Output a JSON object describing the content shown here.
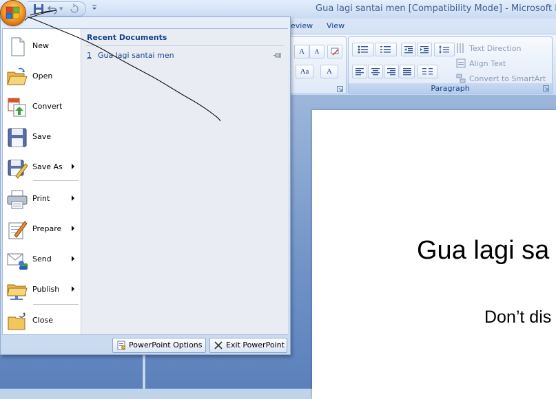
{
  "window": {
    "title": "Gua lagi santai men [Compatibility Mode] - Microsoft P"
  },
  "quick_access": {
    "icons": [
      "save-icon",
      "undo-icon",
      "redo-icon",
      "customize-dropdown-icon"
    ]
  },
  "ribbon": {
    "tabs": [
      "eview",
      "View"
    ],
    "paragraph": {
      "label": "Paragraph",
      "text_direction": "Text Direction",
      "align_text": "Align Text",
      "convert_smartart": "Convert to SmartArt"
    },
    "font_buttons": [
      "A",
      "A",
      "Aa",
      "A"
    ]
  },
  "office_menu": {
    "items": [
      {
        "label": "New",
        "icon": "new-document-icon",
        "submenu": false
      },
      {
        "label": "Open",
        "icon": "open-folder-icon",
        "submenu": false
      },
      {
        "label": "Convert",
        "icon": "convert-icon",
        "submenu": false
      },
      {
        "label": "Save",
        "icon": "save-disk-icon",
        "submenu": false
      },
      {
        "label": "Save As",
        "icon": "save-as-icon",
        "submenu": true
      },
      {
        "label": "Print",
        "icon": "printer-icon",
        "submenu": true
      },
      {
        "label": "Prepare",
        "icon": "prepare-pen-icon",
        "submenu": true
      },
      {
        "label": "Send",
        "icon": "send-icon",
        "submenu": true
      },
      {
        "label": "Publish",
        "icon": "publish-icon",
        "submenu": true
      },
      {
        "label": "Close",
        "icon": "close-folder-icon",
        "submenu": false
      }
    ],
    "recent": {
      "header": "Recent Documents",
      "items": [
        {
          "number": "1",
          "name": "Gua lagi santai men"
        }
      ]
    },
    "footer": {
      "options_label": "PowerPoint Options",
      "exit_label": "Exit PowerPoint"
    }
  },
  "slide": {
    "title": "Gua lagi sa",
    "subtitle": "Don’t dis"
  },
  "colors": {
    "accent": "#15428b",
    "office_button": "#f7a234",
    "workspace": "#6f93c7"
  }
}
